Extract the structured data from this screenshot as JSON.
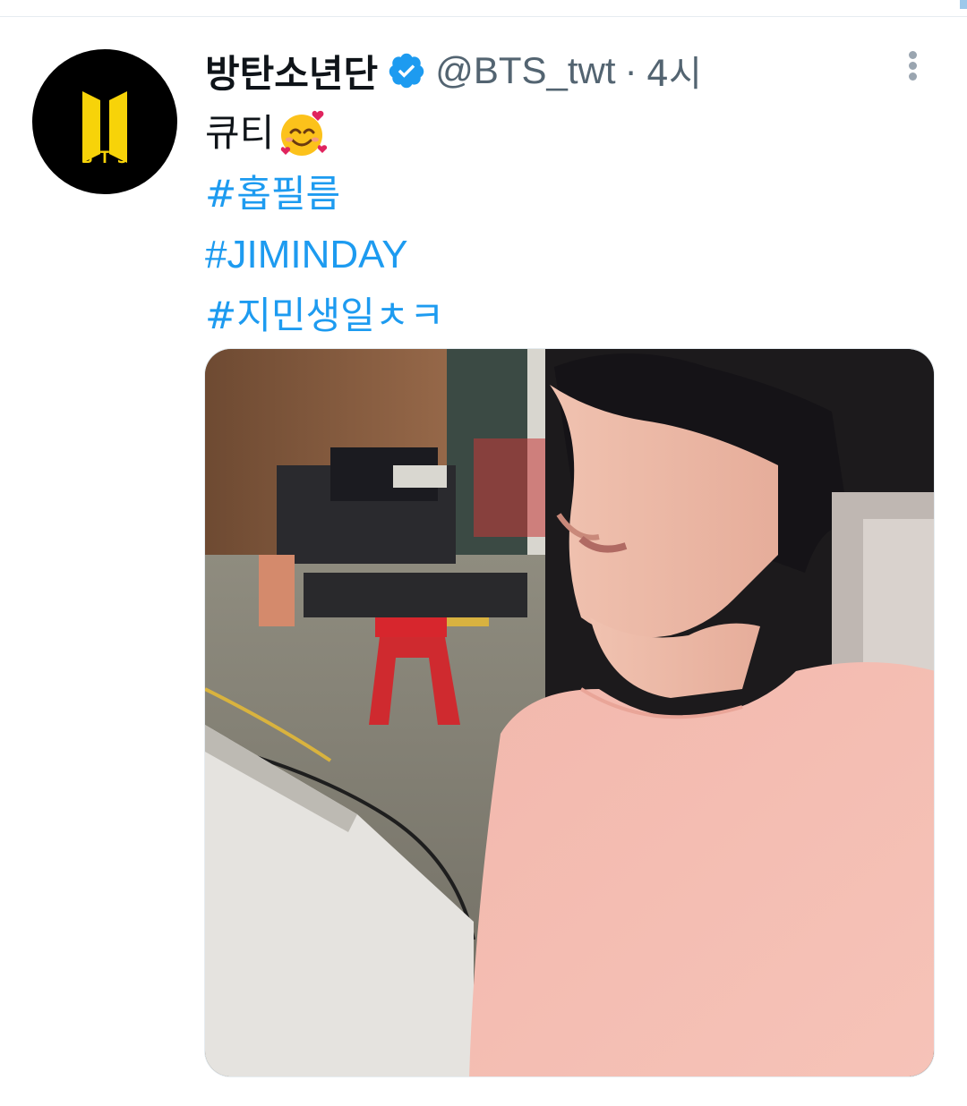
{
  "tweet": {
    "display_name": "방탄소년단",
    "handle": "@BTS_twt",
    "separator": "·",
    "timestamp": "4시",
    "text": "큐티",
    "emoji": "smiling-face-with-hearts-emoji",
    "hashtags": [
      "#홉필름",
      "#JIMINDAY",
      "#지민생일ㅊㅋ"
    ],
    "verified": true
  },
  "avatar": {
    "text": "BTS",
    "logo_color": "#f7d309",
    "background_color": "#000000"
  },
  "colors": {
    "hashtag": "#1d9bf0",
    "verified_badge": "#1d9bf0",
    "secondary_text": "#536471",
    "primary_text": "#0f1419"
  },
  "icons": {
    "more": "more-vertical-icon",
    "verified": "verified-badge-icon"
  }
}
